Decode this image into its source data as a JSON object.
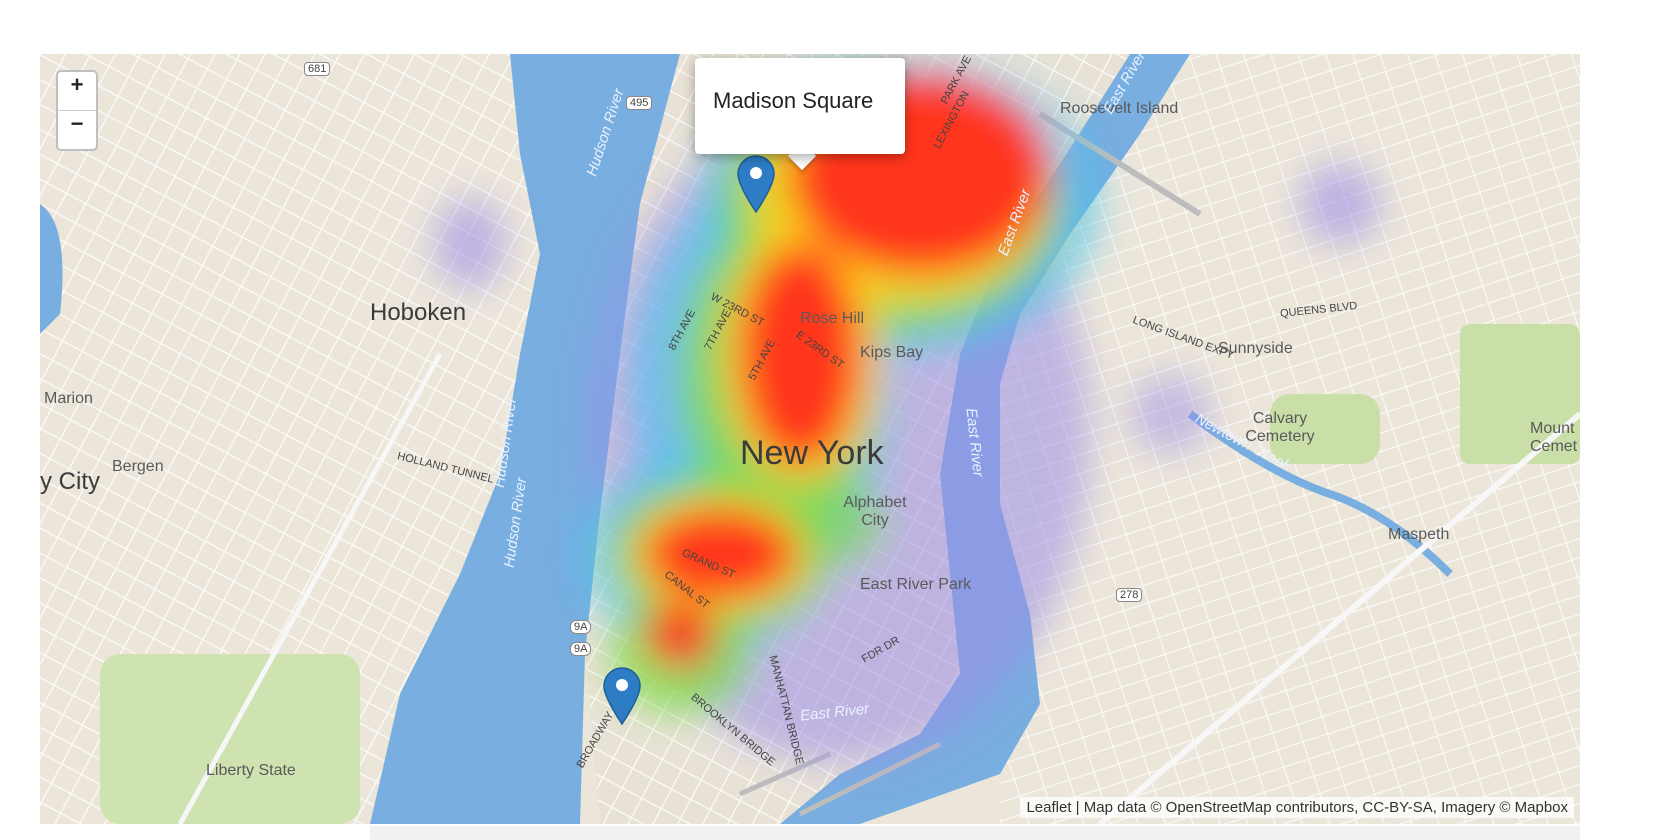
{
  "map": {
    "zoom_in": "+",
    "zoom_out": "−",
    "popup_text": "Madison Square",
    "attribution": "Leaflet | Map data © OpenStreetMap contributors, CC-BY-SA, Imagery © Mapbox",
    "water_color": "#79aee0",
    "land_color": "#ece6da",
    "heat_colors": [
      "#ff2b1f",
      "#ffd21a",
      "#7ddc4a",
      "#3fc3f0",
      "#9b8de8"
    ],
    "places": {
      "hoboken": "Hoboken",
      "new_york": "New York",
      "bergen": "Bergen",
      "city": "y City",
      "marion": "Marion",
      "sunnyside": "Sunnyside",
      "maspeth": "Maspeth",
      "roosevelt_island": "Roosevelt Island",
      "rose_hill": "Rose Hill",
      "kips_bay": "Kips Bay",
      "alphabet_city": "Alphabet City",
      "east_river_park": "East River Park",
      "calvary_cemetery": "Calvary Cemetery",
      "mount_cemetery": "Mount Cemet",
      "liberty_state": "Liberty State"
    },
    "water": {
      "hudson_river_1": "Hudson River",
      "hudson_river_2": "Hudson River",
      "hudson_river_3": "Hudson River",
      "east_river_1": "East River",
      "east_river_2": "East River",
      "east_river_3": "East River",
      "east_river_4": "East River",
      "newtown_creek": "Newtown Creek"
    },
    "streets": {
      "holland_tunnel": "HOLLAND TUNNEL",
      "canal_st": "CANAL ST",
      "grand_st": "GRAND ST",
      "broadway": "BROADWAY",
      "w_23rd": "W 23RD ST",
      "e_23rd": "E 23RD ST",
      "fifth_ave": "5TH AVE",
      "seventh_ave": "7TH AVE",
      "eighth_ave": "8TH AVE",
      "lexington": "LEXINGTON",
      "park_ave": "PARK AVE",
      "queens_blvd": "QUEENS BLVD",
      "long_island_expy": "LONG ISLAND EXPY",
      "brooklyn_bridge": "BROOKLYN BRIDGE",
      "manhattan_bridge": "MANHATTAN BRIDGE",
      "fdr_dr": "FDR DR",
      "route_495": "495",
      "route_681": "681",
      "route_278": "278",
      "route_9a_1": "9A",
      "route_9a_2": "9A"
    }
  }
}
